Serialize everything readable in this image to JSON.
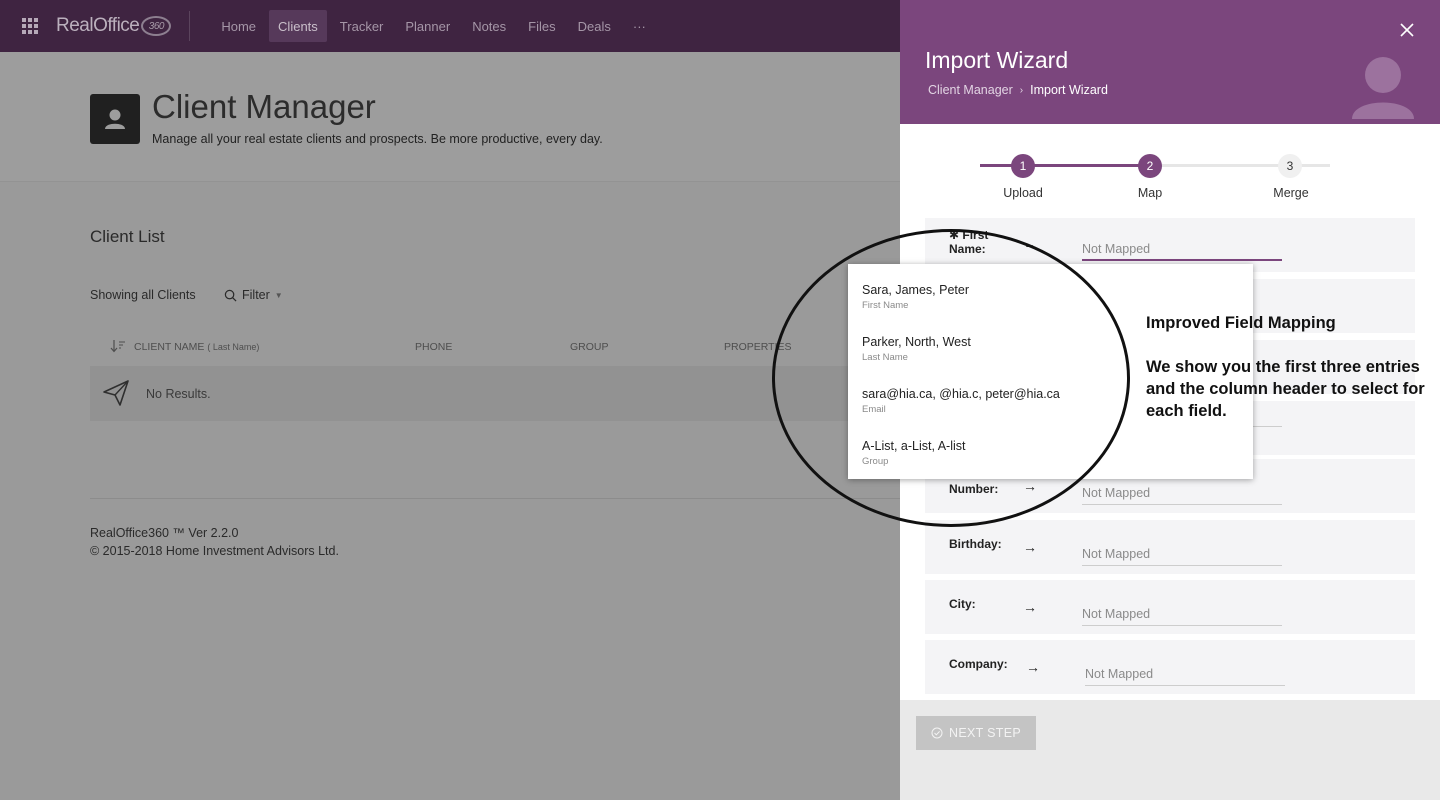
{
  "app": {
    "logo_text": "RealOffice",
    "logo_badge": "360",
    "nav": [
      "Home",
      "Clients",
      "Tracker",
      "Planner",
      "Notes",
      "Files",
      "Deals",
      "···"
    ]
  },
  "page": {
    "title": "Client Manager",
    "subtitle": "Manage all your real estate clients and prospects. Be more productive, every day.",
    "list_title": "Client List",
    "showing": "Showing all Clients",
    "filter_label": "Filter",
    "columns": {
      "client_name": "CLIENT NAME",
      "client_name_hint": "( Last Name)",
      "phone": "PHONE",
      "group": "GROUP",
      "properties": "PROPERTIES"
    },
    "empty": "No Results.",
    "version": "RealOffice360 ™ Ver 2.2.0",
    "copyright": "© 2015-2018 Home Investment Advisors Ltd."
  },
  "wizard": {
    "title": "Import Wizard",
    "breadcrumb": [
      "Client Manager",
      "Import Wizard"
    ],
    "steps": [
      {
        "num": "1",
        "label": "Upload"
      },
      {
        "num": "2",
        "label": "Map"
      },
      {
        "num": "3",
        "label": "Merge"
      }
    ],
    "first_field": {
      "label_prefix": "✱ First",
      "label_rest": "Name:",
      "value": "Not Mapped"
    },
    "fields": [
      {
        "label_top": "",
        "label": "Number:",
        "value": "Not Mapped"
      },
      {
        "label_top": "",
        "label": "Birthday:",
        "value": "Not Mapped"
      },
      {
        "label_top": "",
        "label": "City:",
        "value": "Not Mapped"
      },
      {
        "label_top": "",
        "label": "Company:",
        "value": "Not Mapped"
      }
    ],
    "next_label": "NEXT STEP"
  },
  "dropdown": {
    "options": [
      {
        "preview": "Sara, James, Peter",
        "header": "First Name"
      },
      {
        "preview": "Parker, North, West",
        "header": "Last Name"
      },
      {
        "preview": "sara@hia.ca, @hia.c, peter@hia.ca",
        "header": "Email"
      },
      {
        "preview": "A-List, a-List, A-list",
        "header": "Group"
      }
    ]
  },
  "annotation": {
    "title": "Improved Field Mapping",
    "body": "We show you the first three entries and the column header to select for each field."
  },
  "colors": {
    "accent": "#7b467d",
    "nav_bg": "#3f2441"
  }
}
